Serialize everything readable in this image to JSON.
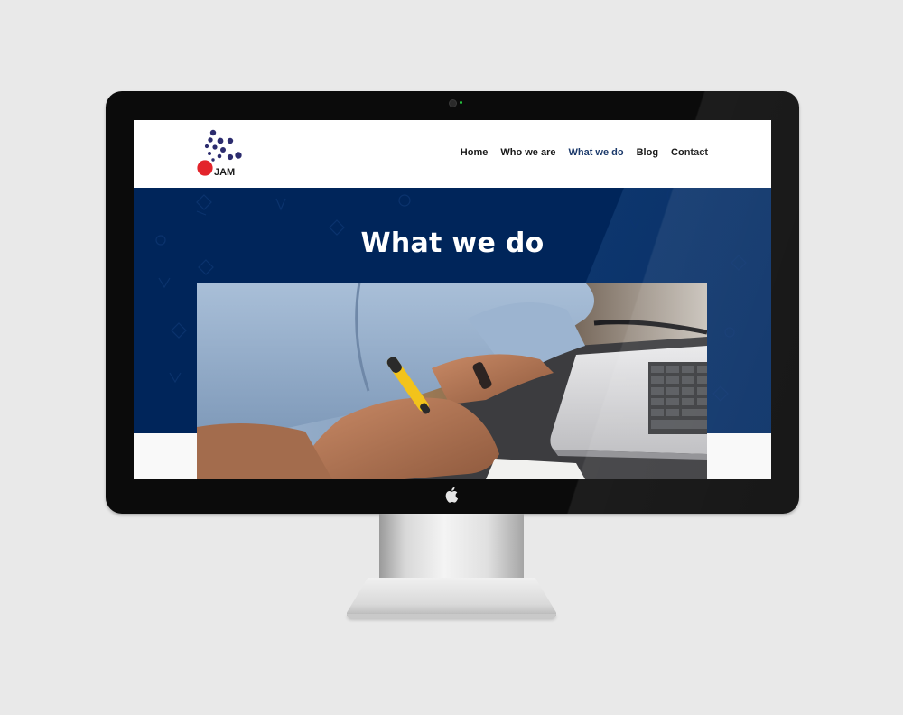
{
  "site": {
    "logo_text": "JAM",
    "nav": [
      {
        "label": "Home",
        "active": false
      },
      {
        "label": "Who we are",
        "active": false
      },
      {
        "label": "What we do",
        "active": true
      },
      {
        "label": "Blog",
        "active": false
      },
      {
        "label": "Contact",
        "active": false
      }
    ],
    "hero_title": "What we do"
  },
  "colors": {
    "page_bg": "#e9e9e9",
    "hero_bg": "#00255a",
    "nav_active": "#1c3a6b",
    "logo_dots": "#2c2c6e",
    "logo_red": "#e3242b"
  },
  "icons": [
    "apple-icon",
    "camera-icon"
  ]
}
